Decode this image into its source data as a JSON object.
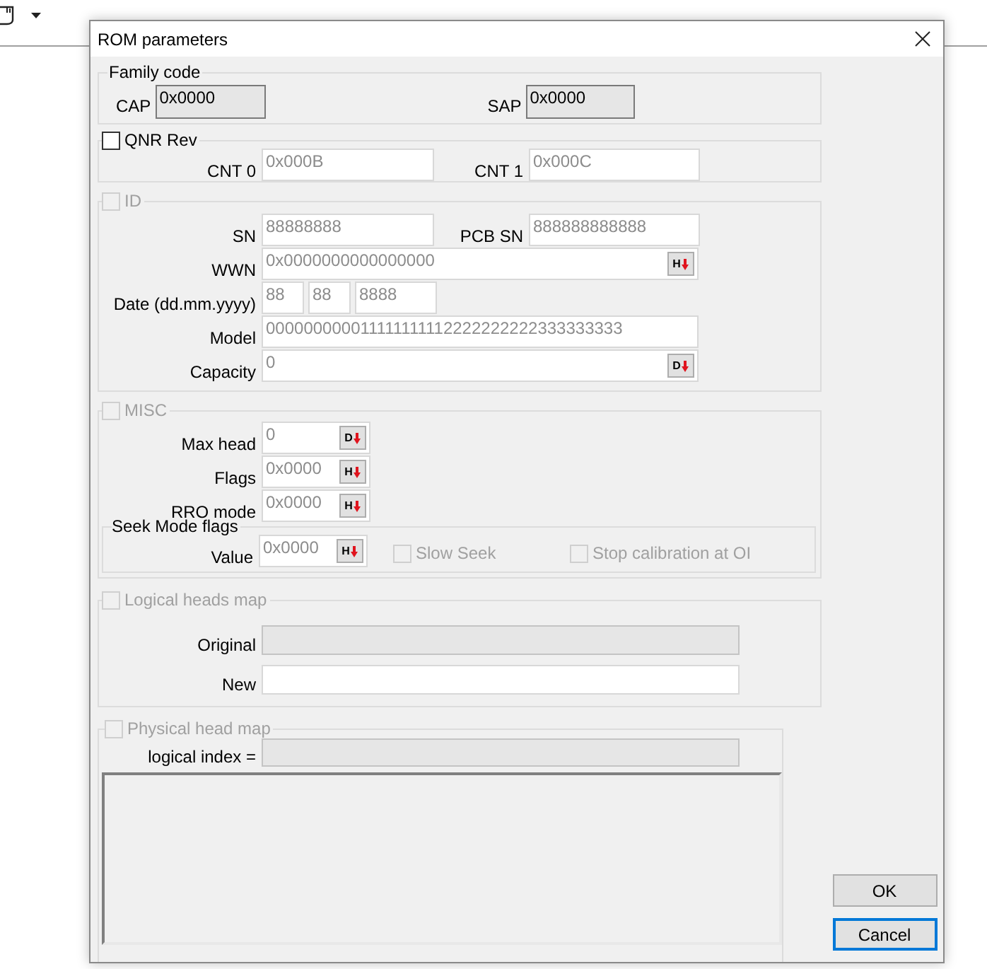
{
  "window": {
    "title": "ROM parameters"
  },
  "family_code": {
    "legend": "Family code",
    "fields": [
      {
        "label": "CAP",
        "value": "0x0000",
        "readonly": true,
        "disabled": false
      },
      {
        "label": "SAP",
        "value": "0x0000",
        "readonly": true,
        "disabled": false
      }
    ]
  },
  "qnr_rev": {
    "label": "QNR Rev",
    "checked": false,
    "disabled": false,
    "fields": [
      {
        "label": "CNT 0",
        "value": "0x000B",
        "readonly": false,
        "disabled": true
      },
      {
        "label": "CNT 1",
        "value": "0x000C",
        "readonly": false,
        "disabled": true
      }
    ]
  },
  "id": {
    "label": "ID",
    "checked": false,
    "disabled": true,
    "sn": {
      "label": "SN",
      "value": "88888888",
      "readonly": false,
      "disabled": true
    },
    "pcb_sn": {
      "label": "PCB SN",
      "value": "888888888888",
      "readonly": false,
      "disabled": true
    },
    "wwn": {
      "label": "WWN",
      "value": "0x0000000000000000",
      "readonly": false,
      "disabled": true,
      "button": "H"
    },
    "date": {
      "label": "Date (dd.mm.yyyy)",
      "parts": [
        {
          "value": "88",
          "readonly": false,
          "disabled": true
        },
        {
          "value": "88",
          "readonly": false,
          "disabled": true
        },
        {
          "value": "8888",
          "readonly": false,
          "disabled": true
        }
      ]
    },
    "model": {
      "label": "Model",
      "value": "000000000011111111112222222222333333333",
      "readonly": false,
      "disabled": true
    },
    "capacity": {
      "label": "Capacity",
      "value": "0",
      "readonly": false,
      "disabled": true,
      "button": "D"
    }
  },
  "misc": {
    "label": "MISC",
    "checked": false,
    "disabled": true,
    "fields": [
      {
        "label": "Max head",
        "value": "0",
        "readonly": false,
        "disabled": true,
        "button": "D"
      },
      {
        "label": "Flags",
        "value": "0x0000",
        "readonly": false,
        "disabled": true,
        "button": "H"
      },
      {
        "label": "RRO mode",
        "value": "0x0000",
        "readonly": false,
        "disabled": true,
        "button": "H"
      }
    ],
    "seek_mode": {
      "legend": "Seek Mode flags",
      "value": {
        "label": "Value",
        "value": "0x0000",
        "readonly": false,
        "disabled": true,
        "button": "H"
      },
      "options": [
        {
          "label": "Slow Seek",
          "checked": false,
          "disabled": true
        },
        {
          "label": "Stop calibration at OI",
          "checked": false,
          "disabled": true
        }
      ]
    }
  },
  "logical_heads_map": {
    "label": "Logical heads map",
    "checked": false,
    "disabled": true,
    "fields": [
      {
        "label": "Original",
        "readonly": true
      },
      {
        "label": "New",
        "readonly": false
      }
    ]
  },
  "physical_head_map": {
    "label": "Physical head map",
    "checked": false,
    "disabled": true,
    "logical_index": {
      "label": "logical index =",
      "readonly": true
    }
  },
  "buttons": [
    {
      "label": "OK",
      "default": false
    },
    {
      "label": "Cancel",
      "default": true
    }
  ]
}
